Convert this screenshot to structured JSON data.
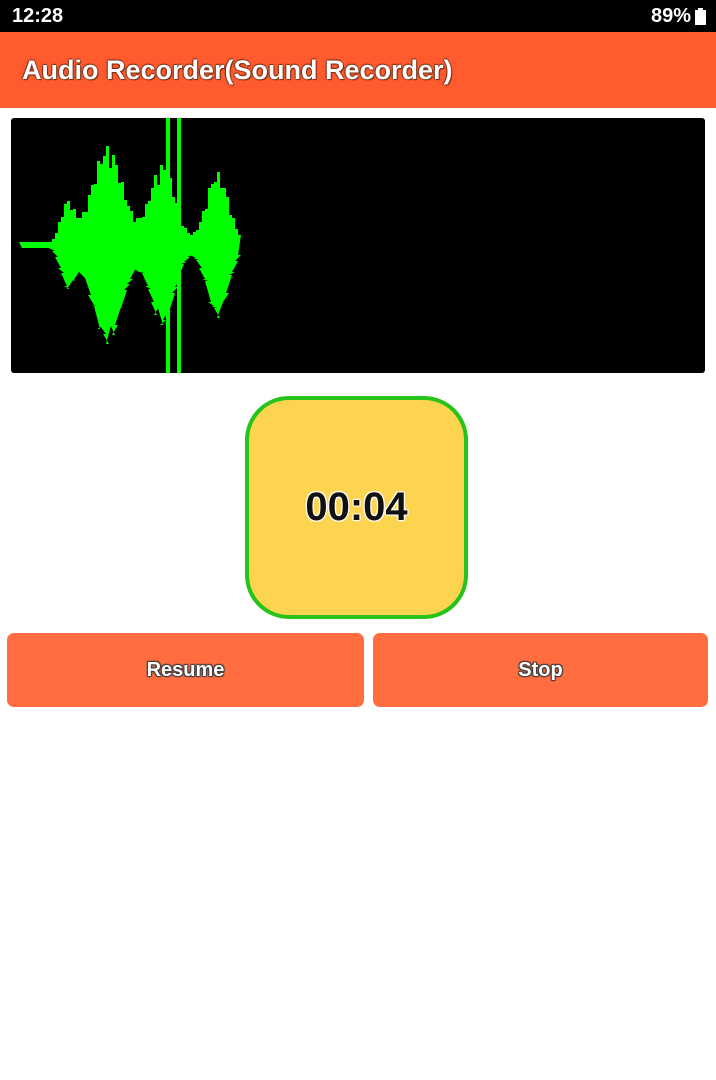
{
  "status_bar": {
    "time": "12:28",
    "battery_percent": "89%",
    "battery_icon": "battery-icon"
  },
  "app_bar": {
    "title": "Audio Recorder(Sound Recorder)",
    "color": "#ff5b2e"
  },
  "visualizer": {
    "background": "#000000",
    "wave_color": "#00ff00"
  },
  "timer": {
    "value": "00:04",
    "fill": "#fdd450",
    "border": "#27c21a"
  },
  "controls": {
    "resume_label": "Resume",
    "stop_label": "Stop",
    "button_color": "#ff6d40"
  }
}
